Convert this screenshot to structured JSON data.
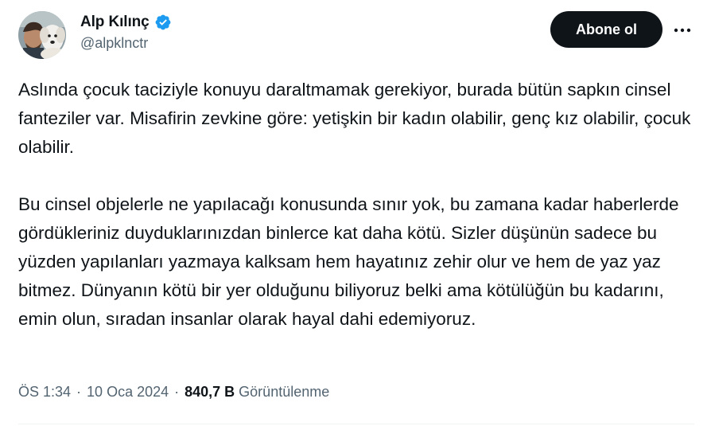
{
  "author": {
    "display_name": "Alp Kılınç",
    "handle": "@alpklnctr",
    "verified": true,
    "avatar_icon": "avatar-photo-dog"
  },
  "actions": {
    "follow_label": "Abone ol",
    "more_icon": "ellipsis-icon"
  },
  "tweet": {
    "paragraphs": [
      "Aslında çocuk taciziyle konuyu daraltmamak gerekiyor, burada bütün sapkın cinsel fanteziler var. Misafirin zevkine göre: yetişkin bir kadın olabilir, genç kız olabilir, çocuk olabilir.",
      "Bu cinsel objelerle ne yapılacağı konusunda sınır yok, bu zamana kadar haberlerde gördükleriniz duyduklarınızdan binlerce kat daha kötü. Sizler düşünün sadece bu yüzden yapılanları yazmaya kalksam hem hayatınız zehir olur ve hem de yaz yaz bitmez. Dünyanın kötü bir yer olduğunu biliyoruz belki ama kötülüğün bu kadarını, emin olun, sıradan insanlar olarak hayal dahi edemiyoruz."
    ]
  },
  "meta": {
    "time": "ÖS 1:34",
    "separator": "·",
    "date": "10 Oca 2024",
    "views_count": "840,7 B",
    "views_label": "Görüntülenme"
  },
  "colors": {
    "text": "#0f1419",
    "secondary": "#536471",
    "verified": "#1d9bf0",
    "button_bg": "#0f1419"
  }
}
